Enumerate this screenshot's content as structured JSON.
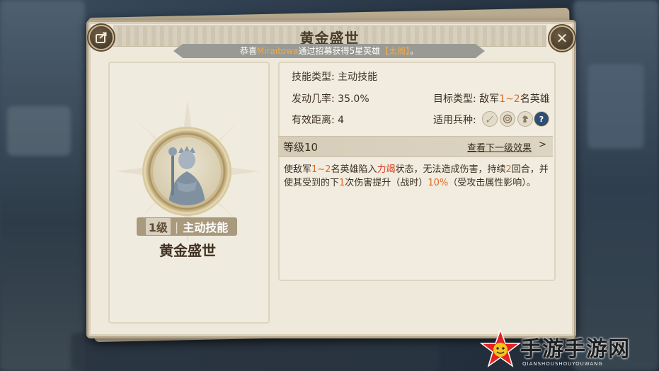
{
  "dialog": {
    "title": "黄金盛世",
    "notice": {
      "prefix": "恭喜",
      "player": "Miraitowa",
      "middle": "通过招募获得5星英雄",
      "hero": "【太阁】",
      "suffix": "。"
    },
    "close_glyph": "✕"
  },
  "skill_card": {
    "level_tag": "1级",
    "separator": "|",
    "type_tag": "主动技能",
    "name": "黄金盛世"
  },
  "details": {
    "skill_type_label": "技能类型:",
    "skill_type_value": "主动技能",
    "trigger_rate_label": "发动几率:",
    "trigger_rate_value": "35.0%",
    "range_label": "有效距离:",
    "range_value": "4",
    "target_type_label": "目标类型:",
    "target_prefix": "敌军",
    "target_range": "1~2",
    "target_suffix": "名英雄",
    "troop_label": "适用兵种:",
    "troop_icons": [
      "sword-icon",
      "target-icon",
      "horse-icon",
      "question-icon"
    ],
    "troop_q": "?"
  },
  "level": {
    "label": "等级10",
    "next_link": "查看下一级效果",
    "arrow": ">"
  },
  "description": {
    "p1": "使敌军",
    "v1": "1~2",
    "p2": "名英雄陷入",
    "status": "力竭",
    "p3": "状态，无法造成伤害，持续",
    "v2": "2",
    "p4": "回合，并使其受到的下",
    "v3": "1",
    "p5": "次伤害提升（战时）",
    "v4": "10%",
    "p6": "（受攻击属性影响）。"
  },
  "watermark": {
    "text": "手游手游网",
    "sub": "QIANSHOUSHOUYOUWANG"
  },
  "colors": {
    "highlight_orange": "#e06a1c",
    "status_red": "#d93a1f",
    "notice_gold": "#f2a944"
  }
}
